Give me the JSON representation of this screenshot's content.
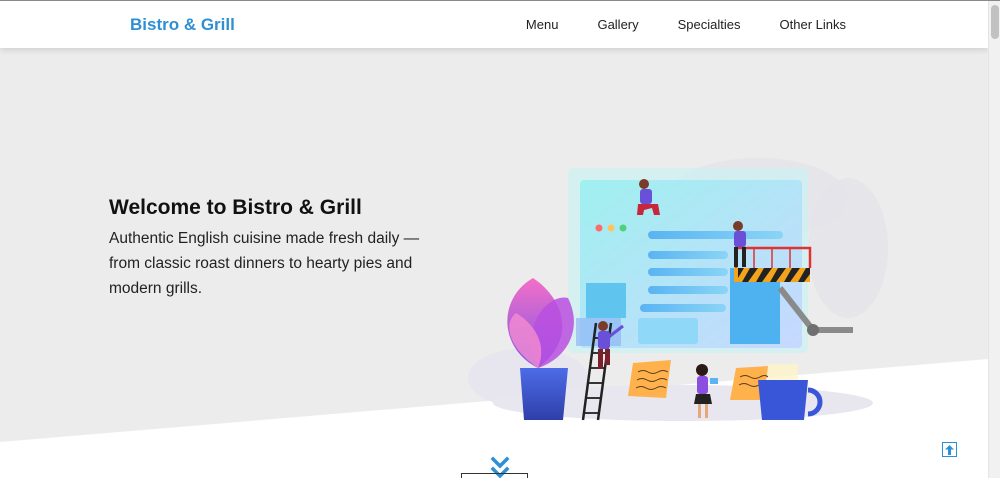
{
  "navbar": {
    "brand": "Bistro & Grill",
    "links": [
      {
        "label": "Menu"
      },
      {
        "label": "Gallery"
      },
      {
        "label": "Specialties"
      },
      {
        "label": "Other Links"
      }
    ]
  },
  "hero": {
    "title": "Welcome to Bistro & Grill",
    "description": "Authentic English cuisine made fresh daily — from classic roast dinners to hearty pies and modern grills."
  },
  "icons": {
    "scroll_down": "double-chevron-down-icon",
    "back_to_top": "arrow-up-icon"
  },
  "colors": {
    "brand": "#2e8fd4",
    "hero_background": "#ececec",
    "text": "#222222"
  }
}
